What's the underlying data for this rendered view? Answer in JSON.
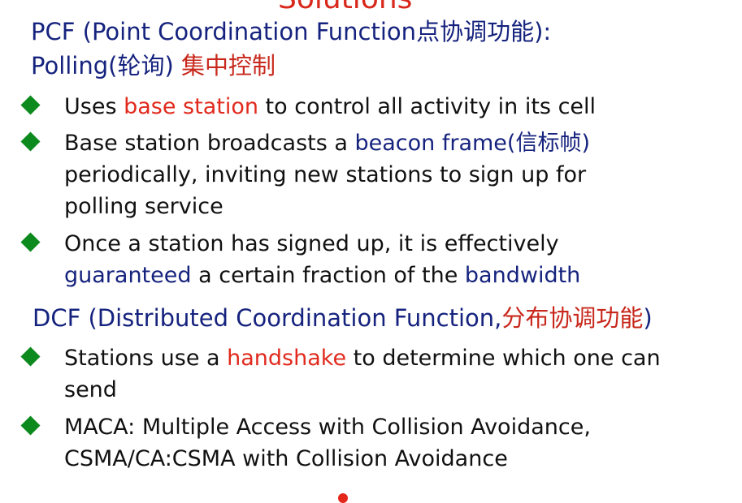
{
  "title": "Solutions",
  "pcf": {
    "heading_a": "PCF (Point Coordination Function",
    "heading_cn": "点协调功能",
    "heading_b": "):",
    "polling_a": "Polling(",
    "polling_cn": "轮询",
    "polling_b": ") ",
    "polling_cn2": "集中控制",
    "bullets": [
      {
        "t1": "Uses ",
        "t2": "base station",
        "t3": " to control all activity in its cell"
      },
      {
        "t1": "Base station broadcasts a ",
        "t2": "beacon frame(",
        "t2cn": "信标帧",
        "t2b": ")",
        "l2": "periodically, inviting new stations to sign up for",
        "l3": "polling service"
      },
      {
        "t1": "Once a station has signed up, it is effectively",
        "l2a": "guaranteed",
        "l2b": " a certain fraction of the ",
        "l2c": "bandwidth"
      }
    ]
  },
  "dcf": {
    "heading_a": "DCF (Distributed Coordination Function,",
    "heading_cn": "分布协调功能",
    "heading_b": ")",
    "bullets": [
      {
        "t1": "Stations use a ",
        "t2": "handshake",
        "t3": " to determine which one can",
        "l2": "send"
      },
      {
        "t1": "MACA: Multiple Access with Collision Avoidance,",
        "l2": "CSMA/CA:CSMA with Collision Avoidance"
      }
    ]
  },
  "colors": {
    "heading": "#16237e",
    "emphasis_red": "#e12a1d",
    "bullet_green": "#0d8a1d",
    "title_red": "#d8281c"
  }
}
